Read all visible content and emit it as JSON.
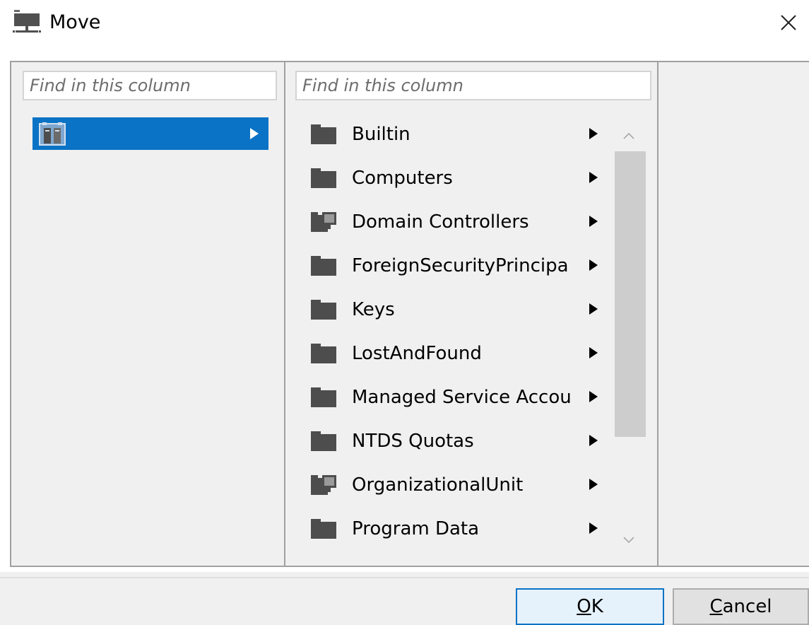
{
  "window": {
    "title": "Move",
    "icon": "computer-network-icon",
    "close_icon": "close-icon"
  },
  "columns": {
    "left": {
      "search_placeholder": "Find in this column",
      "root_item": {
        "icon": "domain-icon",
        "label": "",
        "selected": true
      }
    },
    "middle": {
      "search_placeholder": "Find in this column",
      "items": [
        {
          "label": "Builtin",
          "icon": "folder-icon"
        },
        {
          "label": "Computers",
          "icon": "folder-icon"
        },
        {
          "label": "Domain Controllers",
          "icon": "ou-folder-icon"
        },
        {
          "label": "ForeignSecurityPrincipa",
          "icon": "folder-icon"
        },
        {
          "label": "Keys",
          "icon": "folder-icon"
        },
        {
          "label": "LostAndFound",
          "icon": "folder-icon"
        },
        {
          "label": "Managed Service Accou",
          "icon": "folder-icon"
        },
        {
          "label": "NTDS Quotas",
          "icon": "folder-icon"
        },
        {
          "label": "OrganizationalUnit",
          "icon": "ou-folder-icon"
        },
        {
          "label": "Program Data",
          "icon": "folder-icon"
        }
      ]
    }
  },
  "buttons": {
    "ok": {
      "accel": "O",
      "rest": "K"
    },
    "cancel": {
      "accel": "C",
      "rest": "ancel"
    }
  },
  "colors": {
    "selection": "#0a73c5",
    "folder": "#4d4d4d",
    "background": "#f0f0f0"
  }
}
